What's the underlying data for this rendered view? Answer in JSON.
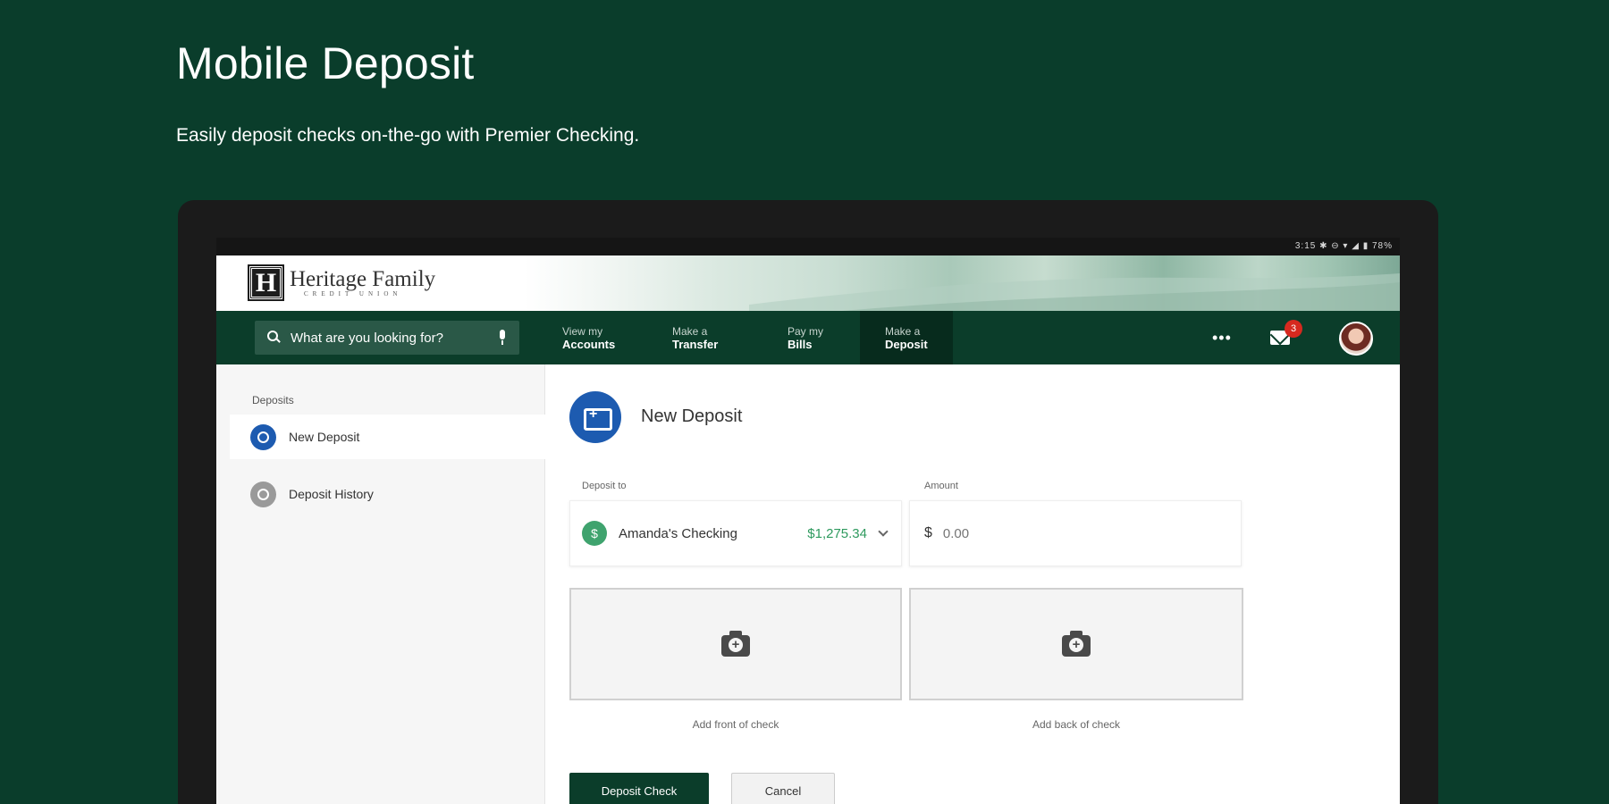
{
  "promo": {
    "title": "Mobile Deposit",
    "subtitle": "Easily deposit checks on-the-go with Premier Checking."
  },
  "statusbar": {
    "text": "3:15 ✱ ⊖ ▾ ◢ ▮ 78%"
  },
  "brand": {
    "logo_mark": "H",
    "name": "Heritage Family",
    "sub": "CREDIT UNION"
  },
  "nav": {
    "search_placeholder": "What are you looking for?",
    "items": [
      {
        "small": "View my",
        "big": "Accounts"
      },
      {
        "small": "Make a",
        "big": "Transfer"
      },
      {
        "small": "Pay my",
        "big": "Bills"
      },
      {
        "small": "Make a",
        "big": "Deposit"
      }
    ],
    "more_label": "•••",
    "mail_badge": "3"
  },
  "sidebar": {
    "title": "Deposits",
    "items": [
      {
        "label": "New Deposit"
      },
      {
        "label": "Deposit History"
      }
    ]
  },
  "main": {
    "title": "New Deposit",
    "deposit_to_label": "Deposit to",
    "amount_label": "Amount",
    "account_icon": "$",
    "account_name": "Amanda's Checking",
    "account_balance": "$1,275.34",
    "currency_symbol": "$",
    "amount_placeholder": "0.00",
    "front_caption": "Add front of check",
    "back_caption": "Add back of check",
    "submit_label": "Deposit Check",
    "cancel_label": "Cancel"
  },
  "colors": {
    "background": "#0a3d2b",
    "nav": "#0b3d2a",
    "accent_blue": "#1d5bb0",
    "balance_green": "#2e9a5e",
    "badge_red": "#d6291f"
  },
  "icons": [
    "search-icon",
    "mic-icon",
    "more-icon",
    "mail-icon",
    "camera-icon",
    "deposit-icon",
    "history-icon",
    "chevron-down-icon",
    "dollar-icon"
  ]
}
